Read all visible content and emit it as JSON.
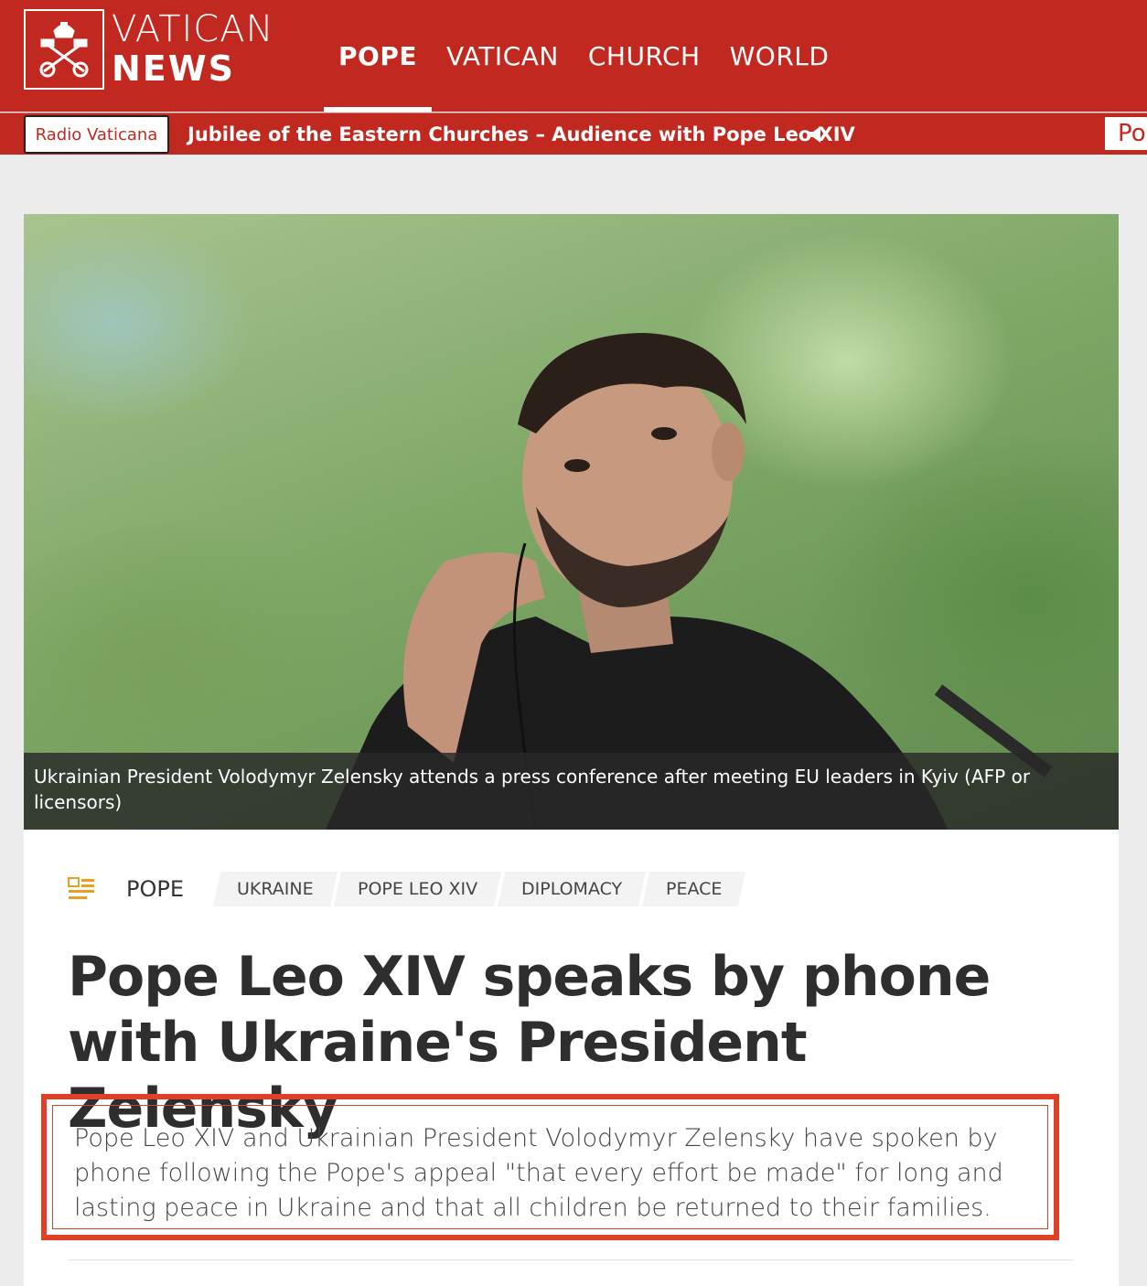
{
  "site": {
    "logo_line1": "VATICAN",
    "logo_line2": "NEWS",
    "brand_color": "#c1281f"
  },
  "nav": {
    "items": [
      {
        "label": "POPE",
        "active": true
      },
      {
        "label": "VATICAN",
        "active": false
      },
      {
        "label": "CHURCH",
        "active": false
      },
      {
        "label": "WORLD",
        "active": false
      }
    ]
  },
  "ticker": {
    "radio_label": "Radio Vaticana",
    "now_playing": "Jubilee of the Eastern Churches – Audience with Pope Leo XIV",
    "right_snippet": "Po"
  },
  "hero": {
    "caption": "Ukrainian President Volodymyr Zelensky attends a press conference after meeting EU leaders in Kyiv  (AFP or licensors)"
  },
  "article": {
    "category": "POPE",
    "tags": [
      "UKRAINE",
      "POPE LEO XIV",
      "DIPLOMACY",
      "PEACE"
    ],
    "title": "Pope Leo XIV speaks by phone with Ukraine's President Zelensky",
    "summary": "Pope Leo XIV and Ukrainian President Volodymyr Zelensky have spoken by phone following the Pope's appeal \"that every effort be made\" for long and lasting peace in Ukraine and that all children be returned to their families.",
    "highlight_color": "#e04028"
  }
}
